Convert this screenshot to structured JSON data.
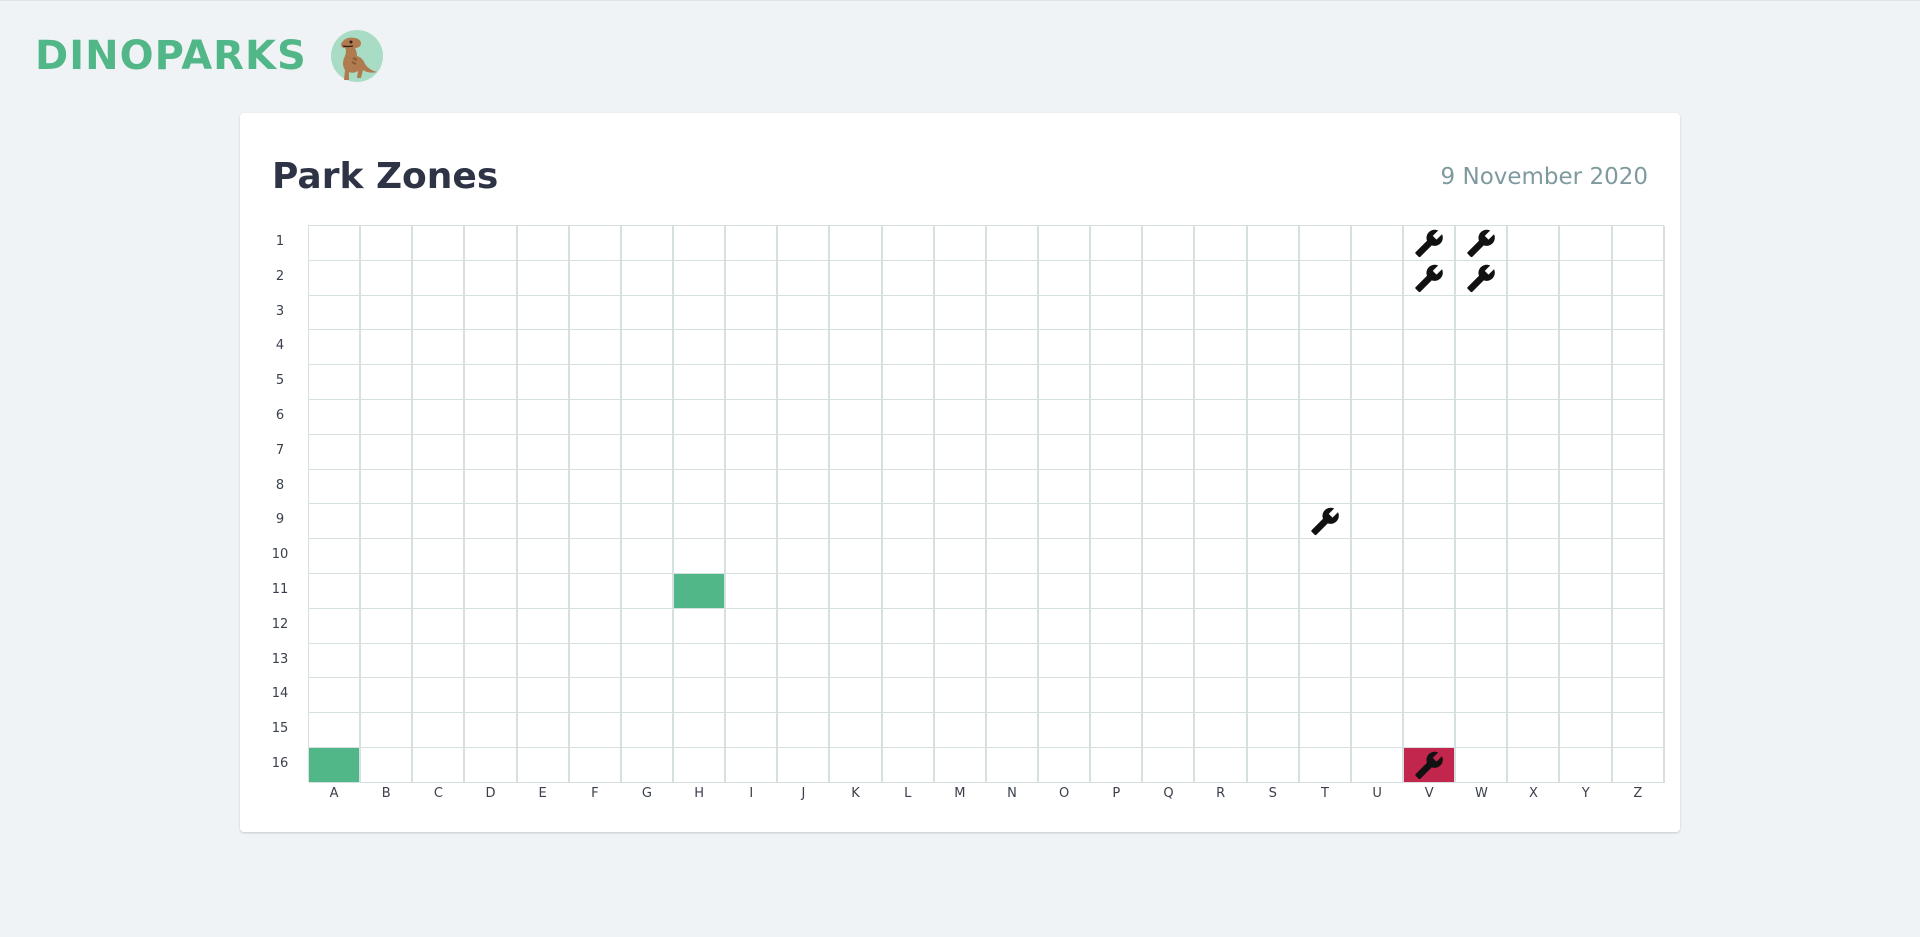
{
  "header": {
    "logo_text": "DINOPARKS",
    "logo_icon": "dinosaur-icon",
    "brand_color": "#52b788"
  },
  "card": {
    "title": "Park Zones",
    "date": "9 November 2020"
  },
  "zones": {
    "rows": [
      "1",
      "2",
      "3",
      "4",
      "5",
      "6",
      "7",
      "8",
      "9",
      "10",
      "11",
      "12",
      "13",
      "14",
      "15",
      "16"
    ],
    "columns": [
      "A",
      "B",
      "C",
      "D",
      "E",
      "F",
      "G",
      "H",
      "I",
      "J",
      "K",
      "L",
      "M",
      "N",
      "O",
      "P",
      "Q",
      "R",
      "S",
      "T",
      "U",
      "V",
      "W",
      "X",
      "Y",
      "Z"
    ],
    "safe_cells": [
      "H11",
      "A16"
    ],
    "danger_cells": [
      "V16"
    ],
    "maintenance_cells": [
      "V1",
      "W1",
      "V2",
      "W2",
      "T9",
      "V16"
    ],
    "maintenance_icon": "wrench-icon",
    "colors": {
      "safe": "#52b788",
      "danger": "#c2264d",
      "grid_line": "#d7e0e1"
    }
  }
}
